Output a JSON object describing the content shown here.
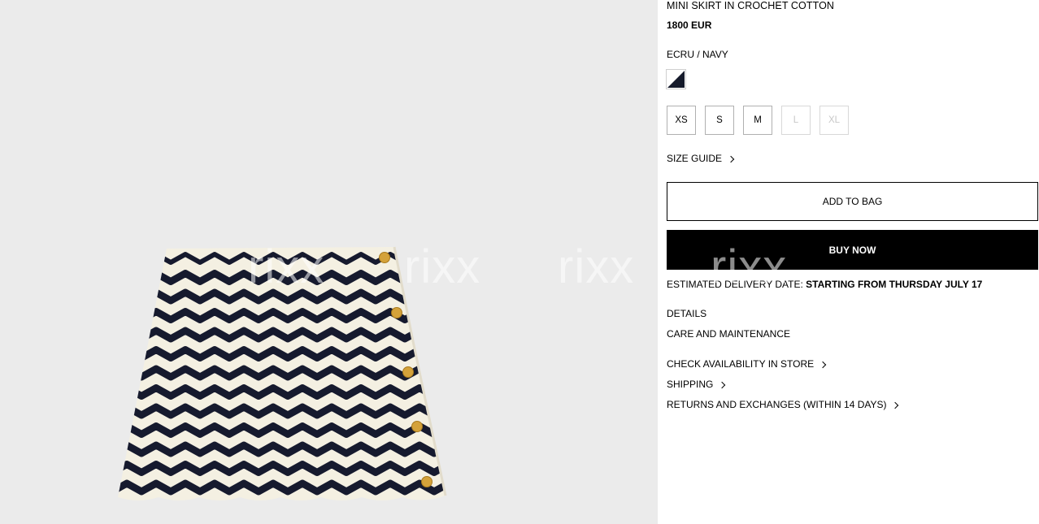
{
  "product": {
    "title": "MINI SKIRT IN CROCHET COTTON",
    "price": "1800 EUR",
    "color_name": "ECRU / NAVY",
    "swatch_colors": {
      "light": "#ffffff",
      "dark": "#151a2b"
    },
    "sizes": [
      {
        "label": "XS",
        "available": true
      },
      {
        "label": "S",
        "available": true
      },
      {
        "label": "M",
        "available": true
      },
      {
        "label": "L",
        "available": false
      },
      {
        "label": "XL",
        "available": false
      }
    ],
    "size_guide_label": "SIZE GUIDE",
    "add_to_bag_label": "ADD TO BAG",
    "buy_now_label": "BUY NOW",
    "delivery_label": "ESTIMATED DELIVERY DATE:",
    "delivery_value": "STARTING FROM THURSDAY JULY 17",
    "details_label": "DETAILS",
    "care_label": "CARE AND MAINTENANCE",
    "check_store_label": "CHECK AVAILABILITY IN STORE",
    "shipping_label": "SHIPPING",
    "returns_label": "RETURNS AND EXCHANGES (WITHIN 14 DAYS)"
  },
  "watermark_text": "rixx",
  "colors": {
    "image_background": "#ebebeb",
    "ecru": "#f4f0e2",
    "navy": "#161a2e",
    "gold": "#d4a23a",
    "disabled_text": "#c8c8c8"
  }
}
